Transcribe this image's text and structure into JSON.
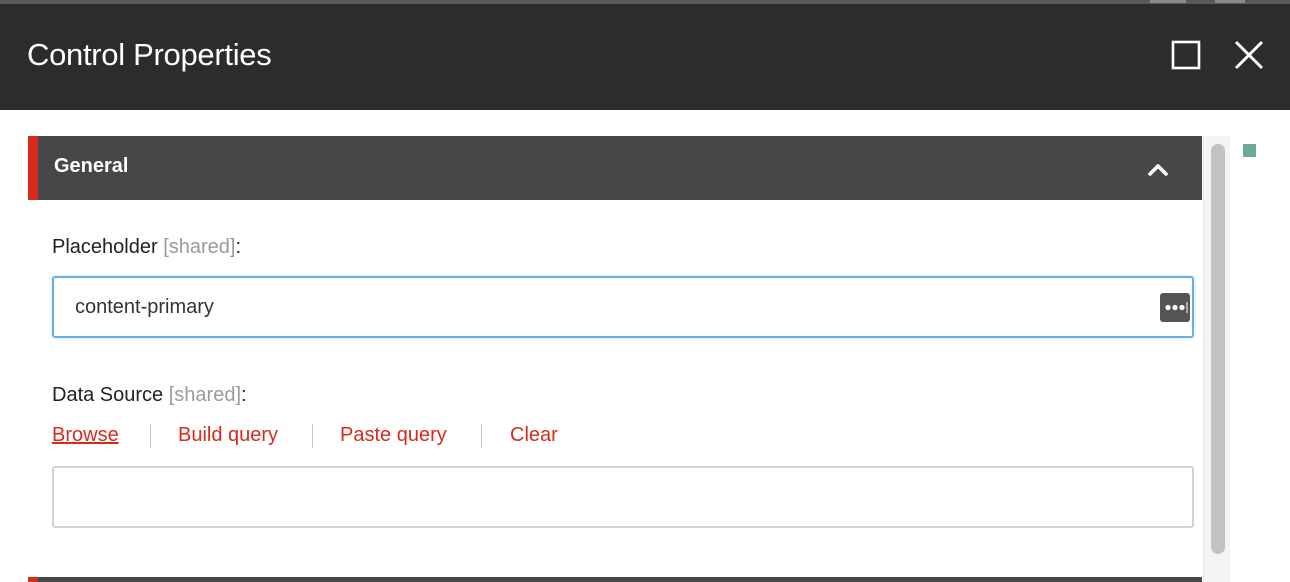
{
  "dialog": {
    "title": "Control Properties",
    "controls": {
      "maximize_icon": "maximize-icon",
      "close_icon": "close-icon"
    }
  },
  "section": {
    "title": "General",
    "collapse_icon": "chevron-up-icon",
    "accent_color": "#d72b1d"
  },
  "placeholder_field": {
    "label": "Placeholder",
    "shared_tag": "[shared]",
    "colon": ":",
    "value": "content-primary",
    "more_icon": "ellipsis-icon"
  },
  "datasource_field": {
    "label": "Data Source",
    "shared_tag": "[shared]",
    "colon": ":",
    "links": [
      "Browse",
      "Build query",
      "Paste query",
      "Clear"
    ],
    "value": ""
  },
  "colors": {
    "header_bg": "#2c2c2c",
    "section_bg": "#474747",
    "link_color": "#d72b1d",
    "focus_border": "#6aaee8",
    "status_indicator": "#6dab90"
  }
}
